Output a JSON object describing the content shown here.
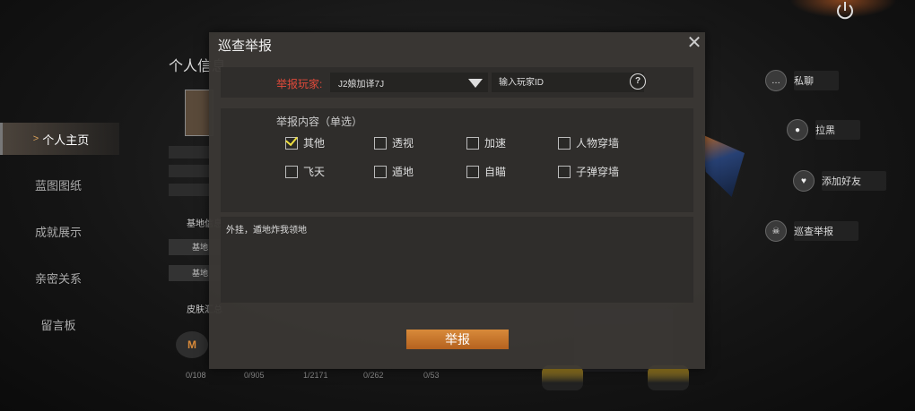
{
  "sidebar": {
    "items": [
      {
        "label": "个人主页",
        "active": true
      },
      {
        "label": "蓝图图纸"
      },
      {
        "label": "成就展示"
      },
      {
        "label": "亲密关系"
      },
      {
        "label": "留言板"
      }
    ]
  },
  "background_panel": {
    "title": "个人信息",
    "section_base": "基地信息",
    "base_rows": [
      "基地",
      "基地"
    ],
    "section_skin": "皮肤汇总",
    "stats": [
      "0/108",
      "0/905",
      "1/2171",
      "0/262",
      "0/53"
    ]
  },
  "actions": [
    {
      "label": "私聊",
      "icon": "chat-icon"
    },
    {
      "label": "拉黑",
      "icon": "block-user-icon"
    },
    {
      "label": "添加好友",
      "icon": "add-friend-icon"
    },
    {
      "label": "巡查举报",
      "icon": "patrol-report-icon"
    }
  ],
  "dialog": {
    "title": "巡查举报",
    "reporter_label": "举报玩家:",
    "reporter_selected": "J2娘加译7J",
    "id_placeholder": "输入玩家ID",
    "content_label": "举报内容（单选）",
    "options": [
      {
        "label": "其他",
        "checked": true
      },
      {
        "label": "透视",
        "checked": false
      },
      {
        "label": "加速",
        "checked": false
      },
      {
        "label": "人物穿墙",
        "checked": false
      },
      {
        "label": "飞天",
        "checked": false
      },
      {
        "label": "遁地",
        "checked": false
      },
      {
        "label": "自瞄",
        "checked": false
      },
      {
        "label": "子弹穿墙",
        "checked": false
      }
    ],
    "reason_text": "外挂，遁地炸我领地",
    "submit_label": "举报"
  },
  "colors": {
    "accent": "#d88a3a",
    "reporter_label": "#e24a3a",
    "check": "#f0e040"
  }
}
